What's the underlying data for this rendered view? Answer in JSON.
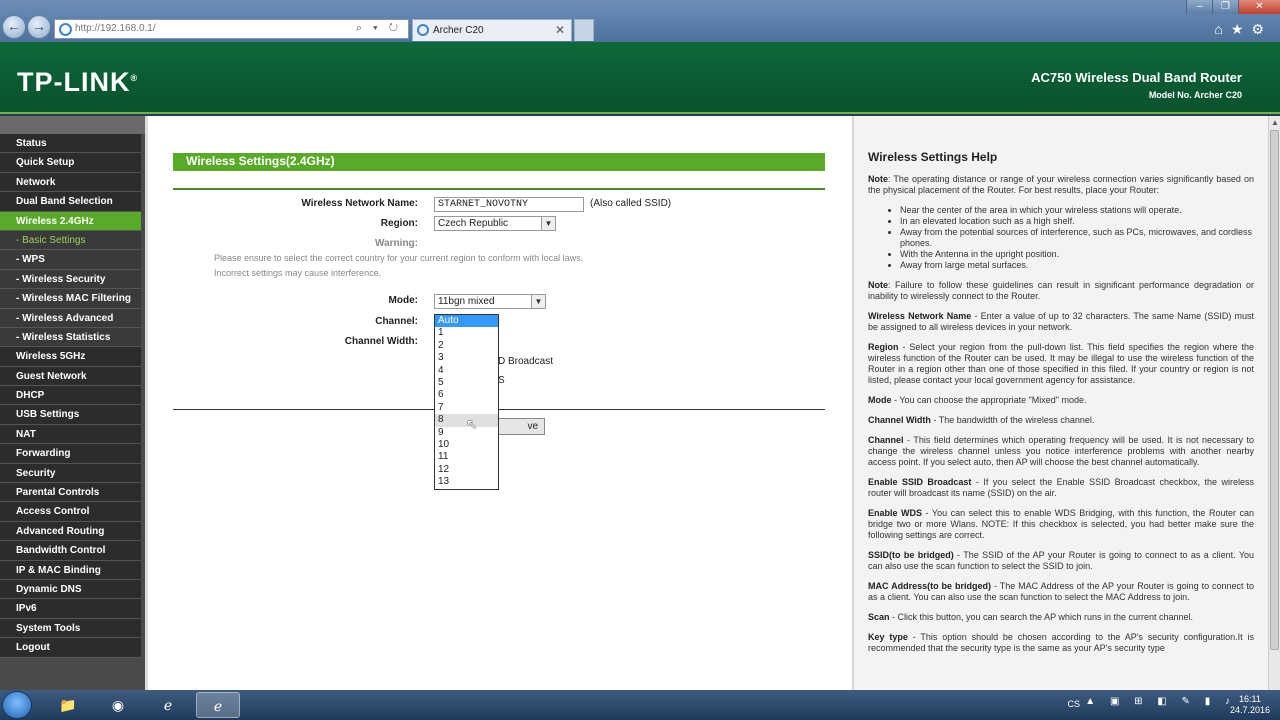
{
  "browser": {
    "url": "http://192.168.0.1/",
    "tab_title": "Archer C20",
    "tools": [
      "⌂",
      "★",
      "⚙"
    ],
    "window_controls": [
      "–",
      "❐",
      "✕"
    ]
  },
  "header": {
    "logo": "TP-LINK",
    "logo_mark": "®",
    "product_name": "AC750 Wireless Dual Band Router",
    "model": "Model No. Archer C20"
  },
  "sidebar": {
    "items": [
      {
        "label": "Status",
        "type": "main"
      },
      {
        "label": "Quick Setup",
        "type": "main"
      },
      {
        "label": "Network",
        "type": "main"
      },
      {
        "label": "Dual Band Selection",
        "type": "main"
      },
      {
        "label": "Wireless 2.4GHz",
        "type": "active"
      },
      {
        "label": "- Basic Settings",
        "type": "sel"
      },
      {
        "label": "- WPS",
        "type": "sub"
      },
      {
        "label": "- Wireless Security",
        "type": "sub"
      },
      {
        "label": "- Wireless MAC Filtering",
        "type": "sub"
      },
      {
        "label": "- Wireless Advanced",
        "type": "sub"
      },
      {
        "label": "- Wireless Statistics",
        "type": "sub"
      },
      {
        "label": "Wireless 5GHz",
        "type": "main"
      },
      {
        "label": "Guest Network",
        "type": "main"
      },
      {
        "label": "DHCP",
        "type": "main"
      },
      {
        "label": "USB Settings",
        "type": "main"
      },
      {
        "label": "NAT",
        "type": "main"
      },
      {
        "label": "Forwarding",
        "type": "main"
      },
      {
        "label": "Security",
        "type": "main"
      },
      {
        "label": "Parental Controls",
        "type": "main"
      },
      {
        "label": "Access Control",
        "type": "main"
      },
      {
        "label": "Advanced Routing",
        "type": "main"
      },
      {
        "label": "Bandwidth Control",
        "type": "main"
      },
      {
        "label": "IP & MAC Binding",
        "type": "main"
      },
      {
        "label": "Dynamic DNS",
        "type": "main"
      },
      {
        "label": "IPv6",
        "type": "main"
      },
      {
        "label": "System Tools",
        "type": "main"
      },
      {
        "label": "Logout",
        "type": "main"
      }
    ]
  },
  "main": {
    "section_title": "Wireless Settings(2.4GHz)",
    "ssid_label": "Wireless Network Name:",
    "ssid_value": "STARNET_NOVOTNY",
    "ssid_hint": "(Also called SSID)",
    "region_label": "Region:",
    "region_value": "Czech Republic",
    "warning_label": "Warning:",
    "warning_line1": "Please ensure to select the correct country for your current region to conform with local laws.",
    "warning_line2": "Incorrect settings may cause interference.",
    "mode_label": "Mode:",
    "mode_value": "11bgn mixed",
    "channel_label": "Channel:",
    "channel_width_label": "Channel Width:",
    "broadcast_partial": "D Broadcast",
    "wds_partial": "S",
    "save_partial": "ve",
    "channel_options": [
      "Auto",
      "1",
      "2",
      "3",
      "4",
      "5",
      "6",
      "7",
      "8",
      "9",
      "10",
      "11",
      "12",
      "13"
    ]
  },
  "help": {
    "title": "Wireless Settings Help",
    "note1_label": "Note",
    "note1_text": ": The operating distance or range of your wireless connection varies significantly based on the physical placement of the Router. For best results, place your Router:",
    "bullets": [
      "Near the center of the area in which your wireless stations will operate.",
      "In an elevated location such as a high shelf.",
      "Away from the potential sources of interference, such as PCs, microwaves, and cordless phones.",
      "With the Antenna in the upright position.",
      "Away from large metal surfaces."
    ],
    "note2_label": "Note",
    "note2_text": ": Failure to follow these guidelines can result in significant performance degradation or inability to wirelessly connect to the Router.",
    "items": [
      {
        "term": "Wireless Network Name",
        "desc": " - Enter a value of up to 32 characters. The same Name (SSID) must be assigned to all wireless devices in your network."
      },
      {
        "term": "Region",
        "desc": " - Select your region from the pull-down list. This field specifies the region where the wireless function of the Router can be used. It may be illegal to use the wireless function of the Router in a region other than one of those specified in this filed. If your country or region is not listed, please contact your local government agency for assistance."
      },
      {
        "term": "Mode",
        "desc": " - You can choose the appropriate \"Mixed\" mode."
      },
      {
        "term": "Channel Width",
        "desc": " - The bandwidth of the wireless channel."
      },
      {
        "term": "Channel",
        "desc": " - This field determines which operating frequency will be used. It is not necessary to change the wireless channel unless you notice interference problems with another nearby access point. If you select auto, then AP will choose the best channel automatically."
      },
      {
        "term": "Enable SSID Broadcast",
        "desc": " - If you select the Enable SSID Broadcast checkbox, the wireless router will broadcast its name (SSID) on the air."
      },
      {
        "term": "Enable WDS",
        "desc": " - You can select this to enable WDS Bridging, with this function, the Router can bridge two or more Wlans. NOTE: If this checkbox is selected, you had better make sure the following settings are correct."
      },
      {
        "term": "SSID(to be bridged)",
        "desc": " - The SSID of the AP your Router is going to connect to as a client. You can also use the scan function to select the SSID to join."
      },
      {
        "term": "MAC Address(to be bridged)",
        "desc": " - The MAC Address of the AP your Router is going to connect to as a client. You can also use the scan function to select the MAC Address to join."
      },
      {
        "term": "Scan",
        "desc": " - Click this button, you can search the AP which runs in the current channel."
      },
      {
        "term": "Key type",
        "desc": " - This option should be chosen according to the AP's security configuration.It is recommended that the security type is the same as your AP's security type"
      }
    ]
  },
  "taskbar": {
    "lang": "CS",
    "time": "16:11",
    "date": "24.7.2016"
  }
}
